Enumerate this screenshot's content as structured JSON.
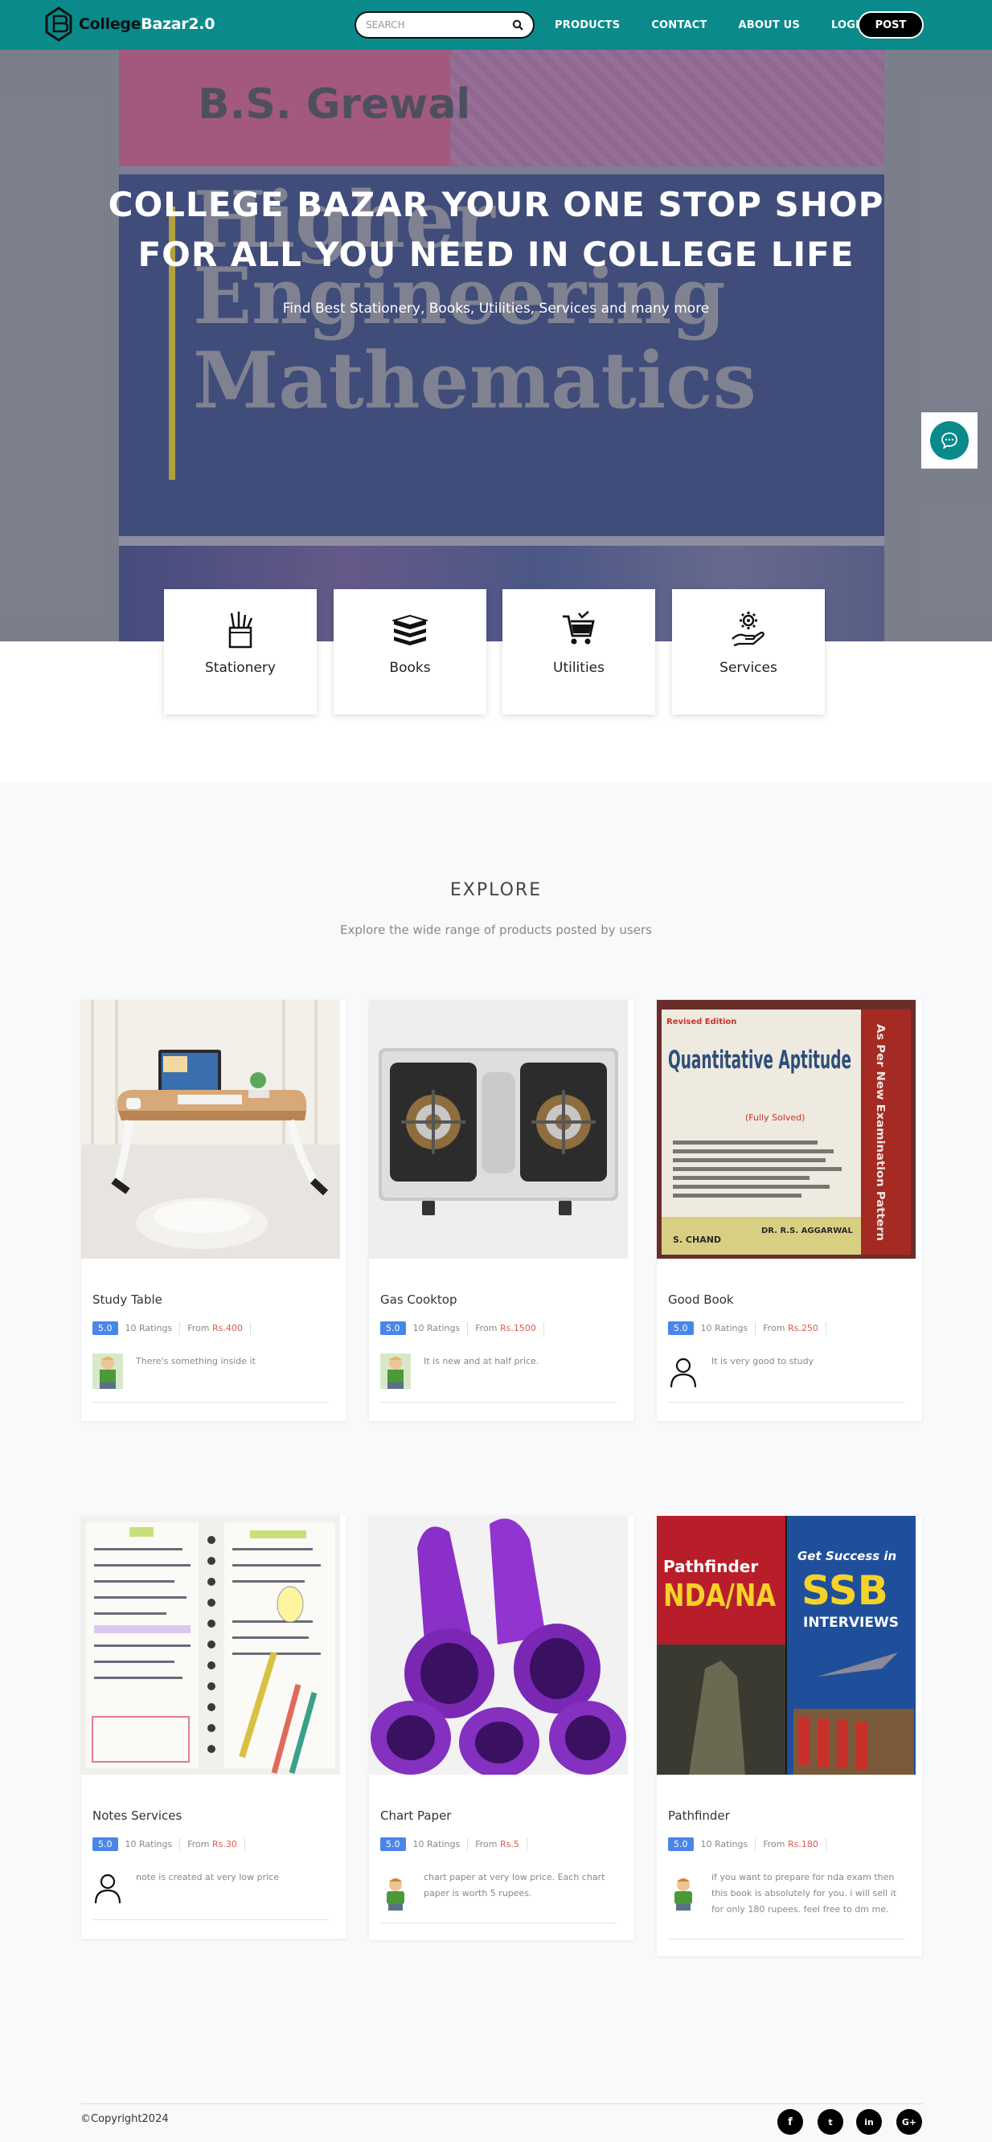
{
  "brand": {
    "name_part1": "College",
    "name_part2": "Bazar2.0",
    "colors": {
      "primary": "#0a8a8a",
      "dark": "#000000",
      "rating": "#4a86e8",
      "price": "#e05a4a"
    }
  },
  "search": {
    "placeholder": "SEARCH",
    "icon": "search-icon"
  },
  "nav": {
    "links": [
      "PRODUCTS",
      "CONTACT",
      "ABOUT US",
      "LOGIN"
    ],
    "post_label": "POST"
  },
  "hero": {
    "title_line1": "COLLEGE BAZAR YOUR ONE STOP SHOP",
    "title_line2": "FOR ALL YOU NEED IN COLLEGE LIFE",
    "subtitle": "Find Best Stationery, Books, Utilities, Services and many more",
    "book_author": "B.S. Grewal",
    "book_title": [
      "Higher",
      "Engineering",
      "Mathematics"
    ]
  },
  "categories": [
    {
      "label": "Stationery",
      "icon": "pencil-cup-icon"
    },
    {
      "label": "Books",
      "icon": "books-stack-icon"
    },
    {
      "label": "Utilities",
      "icon": "shopping-cart-icon"
    },
    {
      "label": "Services",
      "icon": "gear-hand-icon"
    }
  ],
  "explore": {
    "title": "EXPLORE",
    "subtitle": "Explore the wide range of products posted by users"
  },
  "products": [
    {
      "name": "Study Table",
      "rating": "5.0",
      "ratings": "10 Ratings",
      "from": "From",
      "price": "Rs.400",
      "desc": "There's something inside it",
      "avatar": "cartoon-avatar"
    },
    {
      "name": "Gas Cooktop",
      "rating": "5.0",
      "ratings": "10 Ratings",
      "from": "From",
      "price": "Rs.1500",
      "desc": "It is new and at half price.",
      "avatar": "cartoon-avatar"
    },
    {
      "name": "Good Book",
      "rating": "5.0",
      "ratings": "10 Ratings",
      "from": "From",
      "price": "Rs.250",
      "desc": "It is very good to study",
      "avatar": "user-icon"
    },
    {
      "name": "Notes Services",
      "rating": "5.0",
      "ratings": "10 Ratings",
      "from": "From",
      "price": "Rs.30",
      "desc": "note is created at very low price",
      "avatar": "user-icon"
    },
    {
      "name": "Chart Paper",
      "rating": "5.0",
      "ratings": "10 Ratings",
      "from": "From",
      "price": "Rs.5",
      "desc": "chart paper at very low price. Each chart paper is worth 5 rupees.",
      "avatar": "cartoon-avatar"
    },
    {
      "name": "Pathfinder",
      "rating": "5.0",
      "ratings": "10 Ratings",
      "from": "From",
      "price": "Rs.180",
      "desc": "if you want to prepare for nda exam then this book is absolutely for you. i will sell it for only 180 rupees. feel free to dm me.",
      "avatar": "cartoon-avatar"
    }
  ],
  "images": {
    "aptitude_title": "Quantitative Aptitude",
    "aptitude_sub": "(Fully Solved)",
    "aptitude_author": "DR. R.S. AGGARWAL",
    "aptitude_publisher": "S. CHAND",
    "aptitude_edition": "Revised Edition",
    "aptitude_side": "As Per New Examination Pattern",
    "pathfinder_left": "Pathfinder",
    "pathfinder_nda": "NDA/NA",
    "pathfinder_right1": "Get Success in",
    "pathfinder_ssb": "SSB",
    "pathfinder_interviews": "INTERVIEWS"
  },
  "footer": {
    "copyright": "©Copyright2024",
    "social": [
      "f",
      "t",
      "in",
      "G+"
    ]
  }
}
